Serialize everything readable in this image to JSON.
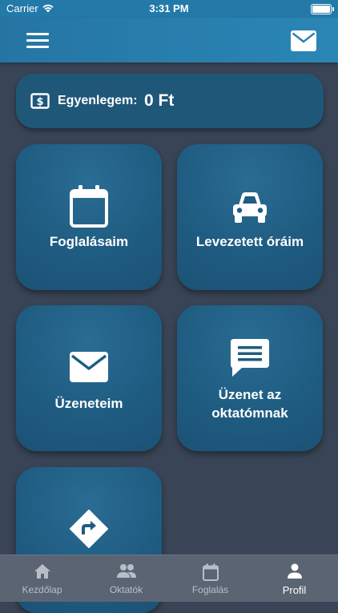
{
  "status_bar": {
    "carrier": "Carrier",
    "time": "3:31 PM"
  },
  "balance": {
    "label": "Egyenlegem:",
    "value": "0 Ft"
  },
  "tiles": [
    {
      "label": "Foglalásaim",
      "icon": "calendar-icon"
    },
    {
      "label": "Levezetett óráim",
      "icon": "car-icon"
    },
    {
      "label": "Üzeneteim",
      "icon": "envelope-icon"
    },
    {
      "label": "Üzenet az oktatómnak",
      "icon": "chat-bubble-icon"
    },
    {
      "label": "",
      "icon": "directions-sign-icon"
    }
  ],
  "tabs": [
    {
      "label": "Kezdőlap",
      "icon": "home-icon"
    },
    {
      "label": "Oktatók",
      "icon": "people-icon"
    },
    {
      "label": "Foglalás",
      "icon": "calendar-icon"
    },
    {
      "label": "Profil",
      "icon": "person-icon",
      "active": true
    }
  ],
  "colors": {
    "background": "#394556",
    "nav_bar": "#237aa9",
    "tile": "#1f5c82",
    "tab_bar": "#5b6472",
    "tab_inactive": "#b8bec8",
    "tab_active": "#ffffff"
  }
}
